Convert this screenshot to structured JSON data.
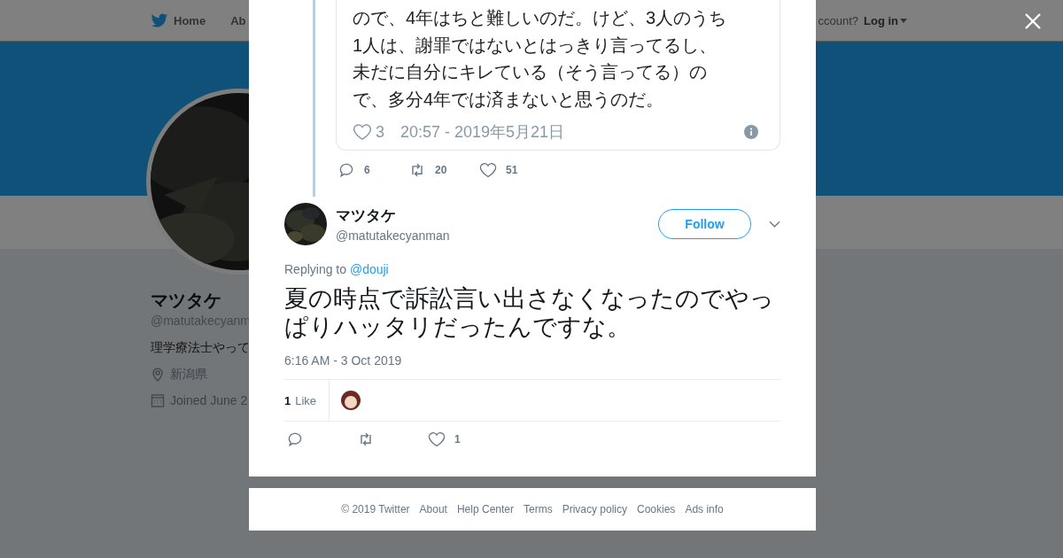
{
  "background_page": {
    "nav": {
      "home": "Home",
      "about": "Ab",
      "account_prompt": "ccount?",
      "login": "Log in"
    },
    "profile": {
      "name": "マツタケ",
      "handle": "@matutakecyanm",
      "bio": "理学療法士やって",
      "location": "新潟県",
      "joined": "Joined June 2"
    }
  },
  "modal": {
    "quoted_tweet": {
      "lines": [
        "ので、4年はちと難しいのだ。けど、3人のうち",
        "1人は、謝罪ではないとはっきり言ってるし、",
        "未だに自分にキレている（そう言ってる）の",
        "で、多分4年では済まないと思うのだ。"
      ],
      "likes": "3",
      "timestamp": "20:57 - 2019年5月21日"
    },
    "parent_actions": {
      "replies": "6",
      "retweets": "20",
      "likes": "51"
    },
    "reply": {
      "name": "マツタケ",
      "handle": "@matutakecyanman",
      "follow": "Follow",
      "replying_label": "Replying to",
      "replying_to": "@douji",
      "text": "夏の時点で訴訟言い出さなくなったのでやっぱりハッタリだったんですな。",
      "timestamp": "6:16 AM - 3 Oct 2019",
      "like_count": "1",
      "like_label": "Like",
      "actions": {
        "likes": "1"
      }
    }
  },
  "footer": [
    "© 2019 Twitter",
    "About",
    "Help Center",
    "Terms",
    "Privacy policy",
    "Cookies",
    "Ads info"
  ]
}
